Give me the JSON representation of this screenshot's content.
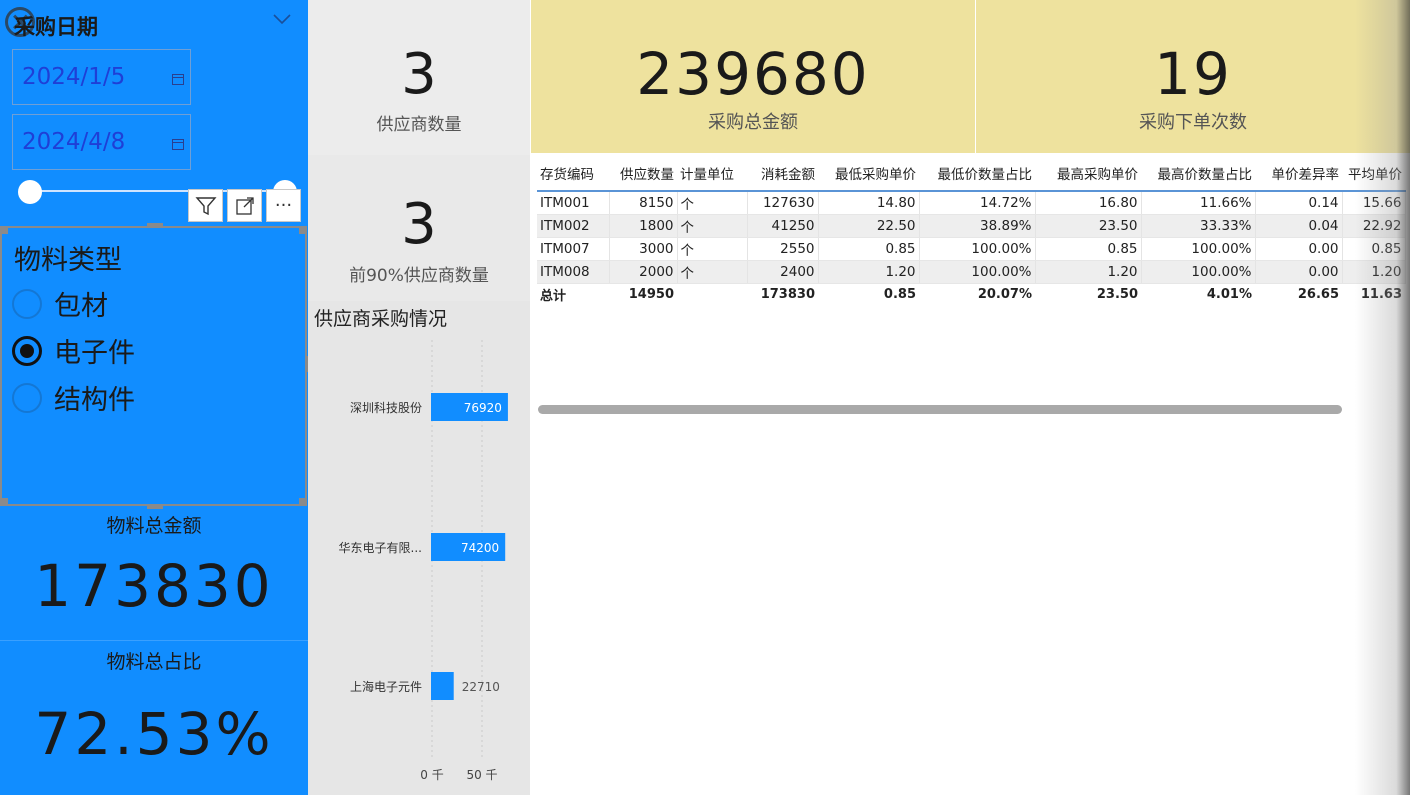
{
  "date_slicer": {
    "title": "采购日期",
    "start": "2024/1/5",
    "end": "2024/4/8"
  },
  "material_slicer": {
    "title": "物料类型",
    "options": [
      {
        "label": "包材",
        "selected": false
      },
      {
        "label": "电子件",
        "selected": true
      },
      {
        "label": "结构件",
        "selected": false
      }
    ]
  },
  "left_kpis": {
    "total_amount_label": "物料总金额",
    "total_amount_value": "173830",
    "total_ratio_label": "物料总占比",
    "total_ratio_value": "72.53%"
  },
  "cards": {
    "supplier_count": {
      "value": "3",
      "label": "供应商数量"
    },
    "top90_supplier_count": {
      "value": "3",
      "label": "前90%供应商数量"
    },
    "total_purchase": {
      "value": "239680",
      "label": "采购总金额"
    },
    "order_count": {
      "value": "19",
      "label": "采购下单次数"
    }
  },
  "toolbar": {
    "filter_icon": "filter-icon",
    "focus_icon": "focus-mode-icon",
    "more_icon": "more-options-icon",
    "more_label": "···"
  },
  "chart_data": {
    "type": "bar",
    "title": "供应商采购情况",
    "orientation": "horizontal",
    "categories": [
      "深圳科技股份",
      "华东电子有限...",
      "上海电子元件"
    ],
    "values": [
      76920,
      74200,
      22710
    ],
    "data_labels": [
      "76920",
      "74200",
      "22710"
    ],
    "x_ticks": [
      "0 千",
      "50 千"
    ],
    "xlim": [
      0,
      50000
    ],
    "bar_color": "#118DFF"
  },
  "table": {
    "headers": [
      "存货编码",
      "供应数量",
      "计量单位",
      "消耗金额",
      "最低采购单价",
      "最低价数量占比",
      "最高采购单价",
      "最高价数量占比",
      "单价差异率",
      "平均单价"
    ],
    "rows": [
      [
        "ITM001",
        "8150",
        "个",
        "127630",
        "14.80",
        "14.72%",
        "16.80",
        "11.66%",
        "0.14",
        "15.66"
      ],
      [
        "ITM002",
        "1800",
        "个",
        "41250",
        "22.50",
        "38.89%",
        "23.50",
        "33.33%",
        "0.04",
        "22.92"
      ],
      [
        "ITM007",
        "3000",
        "个",
        "2550",
        "0.85",
        "100.00%",
        "0.85",
        "100.00%",
        "0.00",
        "0.85"
      ],
      [
        "ITM008",
        "2000",
        "个",
        "2400",
        "1.20",
        "100.00%",
        "1.20",
        "100.00%",
        "0.00",
        "1.20"
      ]
    ],
    "total": [
      "总计",
      "14950",
      "",
      "173830",
      "0.85",
      "20.07%",
      "23.50",
      "4.01%",
      "26.65",
      "11.63"
    ]
  },
  "colors": {
    "accent_blue": "#118DFF",
    "card_yellow": "#EEE29E",
    "panel_grey": "#E6E6E6"
  }
}
